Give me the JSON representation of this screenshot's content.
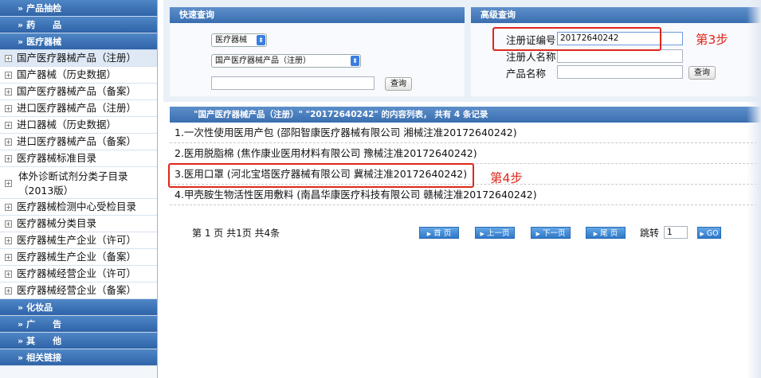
{
  "sidebar": {
    "categories": {
      "product_pick": "产品抽检",
      "drug": "药　　品",
      "device": "医疗器械",
      "cosmetic": "化妆品",
      "ad": "广　　告",
      "other": "其　　他",
      "links": "相关链接"
    },
    "items": [
      "国产医疗器械产品（注册）",
      "国产器械（历史数据）",
      "国产医疗器械产品（备案）",
      "进口医疗器械产品（注册）",
      "进口器械（历史数据）",
      "进口医疗器械产品（备案）",
      "医疗器械标准目录",
      "体外诊断试剂分类子目录（2013版）",
      "医疗器械检测中心受检目录",
      "医疗器械分类目录",
      "医疗器械生产企业（许可）",
      "医疗器械生产企业（备案）",
      "医疗器械经营企业（许可）",
      "医疗器械经营企业（备案）"
    ]
  },
  "quick_search": {
    "title": "快速查询",
    "category_select": "医疗器械",
    "subcategory_select": "国产医疗器械产品（注册）",
    "keyword_value": "",
    "search_label": "查询"
  },
  "advanced_search": {
    "title": "高级查询",
    "reg_no_label": "注册证编号",
    "reg_no_value": "20172640242",
    "registrant_label": "注册人名称",
    "product_label": "产品名称",
    "search_label": "查询"
  },
  "annotations": {
    "step3": "第3步",
    "step4": "第4步"
  },
  "results": {
    "header": "\"国产医疗器械产品（注册）\" \"20172640242\" 的内容列表， 共有 4 条记录",
    "rows": [
      "1.一次性使用医用产包 (邵阳智康医疗器械有限公司 湘械注准20172640242)",
      "2.医用脱脂棉 (焦作康业医用材料有限公司 豫械注准20172640242)",
      "3.医用口罩 (河北宝塔医疗器械有限公司 冀械注准20172640242)",
      "4.甲壳胺生物活性医用敷料 (南昌华康医疗科技有限公司 赣械注准20172640242)"
    ]
  },
  "pager": {
    "info": "第 1 页 共1页 共4条",
    "first": "首 页",
    "prev": "上一页",
    "next": "下一页",
    "last": "尾 页",
    "jump_label": "跳转",
    "jump_value": "1",
    "go": "GO"
  },
  "colors": {
    "header_blue": "#3a6eb0",
    "annotation_red": "#e0261b",
    "pager_blue": "#2f78c8"
  }
}
